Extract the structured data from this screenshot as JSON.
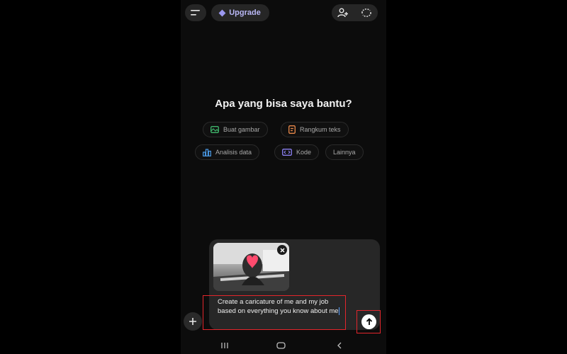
{
  "header": {
    "menu_icon": "menu-icon",
    "upgrade_label": "Upgrade",
    "upgrade_icon": "diamond-icon",
    "add_person_icon": "add-person-icon",
    "temp_chat_icon": "temporary-chat-icon"
  },
  "main": {
    "heading": "Apa yang bisa saya bantu?",
    "suggestions": [
      {
        "label": "Buat gambar",
        "icon": "image-icon",
        "color": "#3fb56b"
      },
      {
        "label": "Rangkum teks",
        "icon": "document-icon",
        "color": "#e8884a"
      },
      {
        "label": "Analisis data",
        "icon": "chart-icon",
        "color": "#4a9be8"
      },
      {
        "label": "Kode",
        "icon": "code-icon",
        "color": "#8a7ff0"
      },
      {
        "label": "Lainnya",
        "icon": "",
        "color": "#a9a9a9"
      }
    ]
  },
  "composer": {
    "attachment": "image-thumbnail",
    "text": "Create a caricature of me and my job based on everything you know about me",
    "highlight_color": "#e3262c"
  },
  "navbar": {
    "recents_icon": "recents-icon",
    "home_icon": "home-icon",
    "back_icon": "back-icon"
  }
}
